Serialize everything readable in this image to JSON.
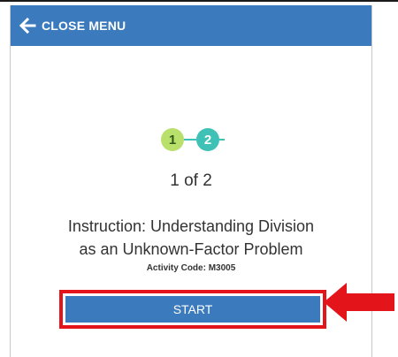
{
  "header": {
    "close_label": "CLOSE MENU",
    "icon": "arrow-left-icon"
  },
  "steps": {
    "items": [
      {
        "number": "1",
        "state": "current"
      },
      {
        "number": "2",
        "state": "upcoming"
      }
    ],
    "colors": {
      "step1": "#b8e06a",
      "step2": "#3fc1b6"
    }
  },
  "progress": {
    "text": "1 of 2"
  },
  "activity": {
    "title_line1": "Instruction: Understanding Division",
    "title_line2": "as an Unknown-Factor Problem",
    "code": "Activity Code: M3005"
  },
  "actions": {
    "start_label": "START"
  },
  "colors": {
    "brand": "#3a7abd",
    "highlight": "#e3151a"
  }
}
